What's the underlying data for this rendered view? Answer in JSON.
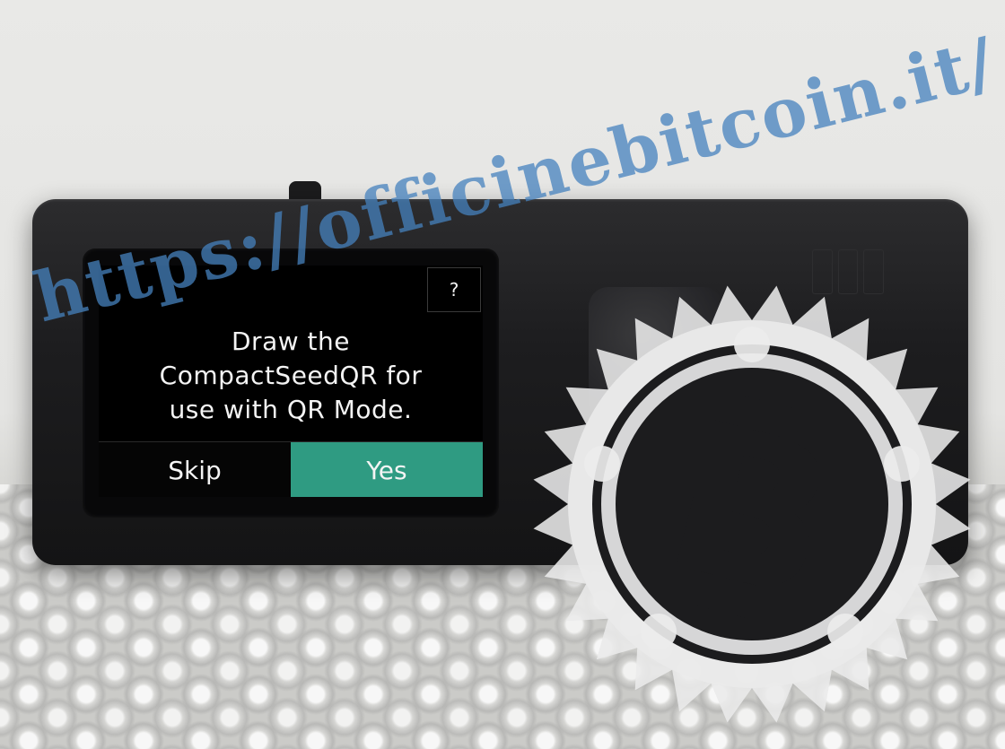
{
  "screen": {
    "help_label": "?",
    "message_lines": [
      "Draw the",
      "CompactSeedQR for",
      "use with QR Mode."
    ],
    "buttons": {
      "skip": "Skip",
      "yes": "Yes"
    }
  },
  "watermark": {
    "url": "https://officinebitcoin.it/"
  },
  "colors": {
    "accent": "#2f9b82",
    "screen_bg": "#000000",
    "watermark": "#4682be"
  },
  "icons": {
    "logo": "bitcoin-gear-logo"
  }
}
